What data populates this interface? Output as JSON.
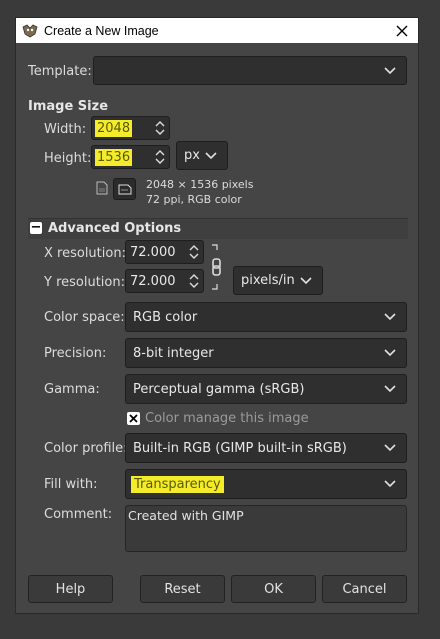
{
  "window": {
    "title": "Create a New Image"
  },
  "template": {
    "label": "Template:",
    "value": ""
  },
  "image_size": {
    "title": "Image Size",
    "width_label": "Width:",
    "width_value": "2048",
    "height_label": "Height:",
    "height_value": "1536",
    "unit": "px",
    "info_pixels": "2048 × 1536 pixels",
    "info_res": "72 ppi, RGB color"
  },
  "advanced": {
    "title": "Advanced Options",
    "expander_symbol": "−",
    "xres_label": "X resolution:",
    "xres_value": "72.000",
    "yres_label": "Y resolution:",
    "yres_value": "72.000",
    "res_unit": "pixels/in",
    "color_space_label": "Color space:",
    "color_space_value": "RGB color",
    "precision_label": "Precision:",
    "precision_value": "8-bit integer",
    "gamma_label": "Gamma:",
    "gamma_value": "Perceptual gamma (sRGB)",
    "color_manage_label": "Color manage this image",
    "color_profile_label": "Color profile:",
    "color_profile_value": "Built-in RGB (GIMP built-in sRGB)",
    "fill_label": "Fill with:",
    "fill_value": "Transparency",
    "comment_label": "Comment:",
    "comment_value": "Created with GIMP"
  },
  "buttons": {
    "help": "Help",
    "reset": "Reset",
    "ok": "OK",
    "cancel": "Cancel"
  },
  "colors": {
    "highlight": "#f4ec2a",
    "bg": "#454545",
    "field": "#2f2f2f"
  },
  "icons": [
    "gimp-app-icon",
    "close-icon",
    "chevron-down-icon",
    "portrait-icon",
    "landscape-icon",
    "chain-link-icon",
    "spin-up-icon",
    "spin-down-icon",
    "checkbox-x-icon"
  ]
}
